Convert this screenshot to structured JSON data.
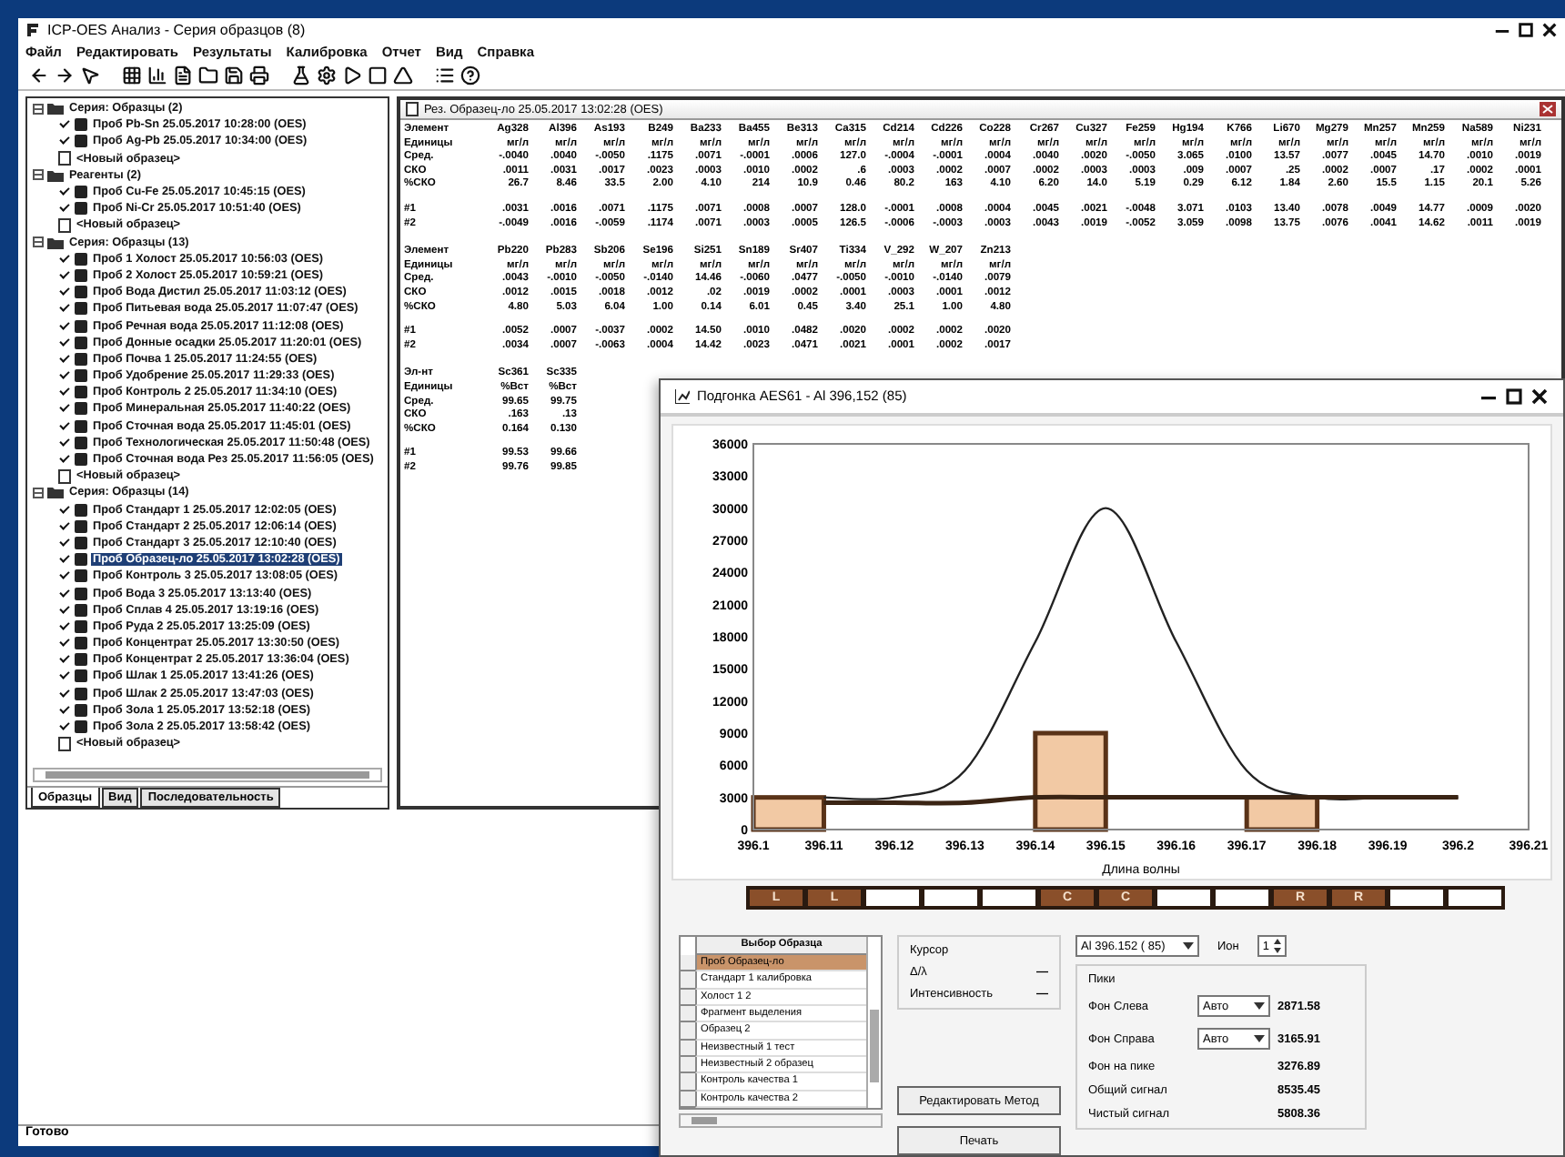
{
  "window": {
    "title": "ICP-OES Анализ - Серия образцов (8)"
  },
  "menu": [
    "Файл",
    "Редактировать",
    "Результаты",
    "Калибровка",
    "Отчет",
    "Вид",
    "Справка"
  ],
  "tree": {
    "groups": [
      {
        "label": "Серия: Образцы (2)",
        "expanded": true,
        "new_item": "<Новый образец>",
        "children": [
          {
            "label": "Проб Pb-Sn 25.05.2017 10:28:00 (OES)",
            "checked": true,
            "selected": false
          },
          {
            "label": "Проб Ag-Pb 25.05.2017 10:34:00 (OES)",
            "checked": true,
            "selected": false
          }
        ]
      },
      {
        "label": "Реагенты (2)",
        "expanded": true,
        "new_item": "<Новый образец>",
        "children": [
          {
            "label": "Проб Cu-Fe 25.05.2017 10:45:15 (OES)",
            "checked": true,
            "selected": false
          },
          {
            "label": "Проб Ni-Cr 25.05.2017 10:51:40 (OES)",
            "checked": true,
            "selected": false
          }
        ]
      },
      {
        "label": "Серия: Образцы (13)",
        "expanded": true,
        "new_item": "<Новый образец>",
        "children": [
          {
            "label": "Проб 1 Холост 25.05.2017 10:56:03 (OES)",
            "checked": true,
            "selected": false
          },
          {
            "label": "Проб 2 Холост 25.05.2017 10:59:21 (OES)",
            "checked": true,
            "selected": false
          },
          {
            "label": "Проб Вода Дистил 25.05.2017 11:03:12 (OES)",
            "checked": true,
            "selected": false
          },
          {
            "label": "Проб Питьевая вода 25.05.2017 11:07:47 (OES)",
            "checked": true,
            "selected": false
          },
          {
            "label": "Проб Речная вода 25.05.2017 11:12:08 (OES)",
            "checked": true,
            "selected": false
          },
          {
            "label": "Проб Донные осадки 25.05.2017 11:20:01 (OES)",
            "checked": true,
            "selected": false
          },
          {
            "label": "Проб Почва 1 25.05.2017 11:24:55 (OES)",
            "checked": true,
            "selected": false
          },
          {
            "label": "Проб Удобрение 25.05.2017 11:29:33 (OES)",
            "checked": true,
            "selected": false
          },
          {
            "label": "Проб Контроль 2 25.05.2017 11:34:10 (OES)",
            "checked": true,
            "selected": false
          },
          {
            "label": "Проб Минеральная 25.05.2017 11:40:22 (OES)",
            "checked": true,
            "selected": false
          },
          {
            "label": "Проб Сточная вода 25.05.2017 11:45:01 (OES)",
            "checked": true,
            "selected": false
          },
          {
            "label": "Проб Технологическая 25.05.2017 11:50:48 (OES)",
            "checked": true,
            "selected": false
          },
          {
            "label": "Проб Сточная вода Рез 25.05.2017 11:56:05 (OES)",
            "checked": true,
            "selected": false
          }
        ]
      },
      {
        "label": "Серия: Образцы (14)",
        "expanded": true,
        "new_item": "<Новый образец>",
        "children": [
          {
            "label": "Проб Стандарт 1 25.05.2017 12:02:05 (OES)",
            "checked": true,
            "selected": false
          },
          {
            "label": "Проб Стандарт 2 25.05.2017 12:06:14 (OES)",
            "checked": true,
            "selected": false
          },
          {
            "label": "Проб Стандарт 3 25.05.2017 12:10:40 (OES)",
            "checked": true,
            "selected": false
          },
          {
            "label": "Проб Образец-ло 25.05.2017 13:02:28 (OES)",
            "checked": true,
            "selected": true
          },
          {
            "label": "Проб Контроль 3 25.05.2017 13:08:05 (OES)",
            "checked": true,
            "selected": false
          },
          {
            "label": "Проб Вода 3 25.05.2017 13:13:40 (OES)",
            "checked": true,
            "selected": false
          },
          {
            "label": "Проб Сплав 4 25.05.2017 13:19:16 (OES)",
            "checked": true,
            "selected": false
          },
          {
            "label": "Проб Руда 2 25.05.2017 13:25:09 (OES)",
            "checked": true,
            "selected": false
          },
          {
            "label": "Проб Концентрат 25.05.2017 13:30:50 (OES)",
            "checked": true,
            "selected": false
          },
          {
            "label": "Проб Концентрат 2 25.05.2017 13:36:04 (OES)",
            "checked": true,
            "selected": false
          },
          {
            "label": "Проб Шлак 1 25.05.2017 13:41:26 (OES)",
            "checked": true,
            "selected": false
          },
          {
            "label": "Проб Шлак 2 25.05.2017 13:47:03 (OES)",
            "checked": true,
            "selected": false
          },
          {
            "label": "Проб Зола 1 25.05.2017 13:52:18 (OES)",
            "checked": true,
            "selected": false
          },
          {
            "label": "Проб Зола 2 25.05.2017 13:58:42 (OES)",
            "checked": true,
            "selected": false
          }
        ]
      }
    ]
  },
  "panel_tabs": [
    {
      "label": "Образцы",
      "selected": true
    },
    {
      "label": "Вид",
      "selected": false
    },
    {
      "label": "Последовательность",
      "selected": false
    }
  ],
  "status_bar": "Готово",
  "results": {
    "title": "Рез. Образец-ло 25.05.2017 13:02:28 (OES)",
    "blocks": [
      {
        "label": "Элемент",
        "columns": [
          "Ag328",
          "Al396",
          "As193",
          "B249",
          "Ba233",
          "Ba455",
          "Be313",
          "Ca315",
          "Cd214",
          "Cd226",
          "Co228",
          "Cr267",
          "Cu327",
          "Fe259",
          "Hg194",
          "K766",
          "Li670",
          "Mg279",
          "Mn257",
          "Mn259",
          "Na589",
          "Ni231"
        ],
        "stats": [
          {
            "label": "Единицы",
            "values": [
              "мг/л",
              "мг/л",
              "мг/л",
              "мг/л",
              "мг/л",
              "мг/л",
              "мг/л",
              "мг/л",
              "мг/л",
              "мг/л",
              "мг/л",
              "мг/л",
              "мг/л",
              "мг/л",
              "мг/л",
              "мг/л",
              "мг/л",
              "мг/л",
              "мг/л",
              "мг/л",
              "мг/л",
              "мг/л"
            ]
          },
          {
            "label": "Сред.",
            "values": [
              "-.0040",
              ".0040",
              "-.0050",
              ".1175",
              ".0071",
              "-.0001",
              ".0006",
              "127.0",
              "-.0004",
              "-.0001",
              ".0004",
              ".0040",
              ".0020",
              "-.0050",
              "3.065",
              ".0100",
              "13.57",
              ".0077",
              ".0045",
              "14.70",
              ".0010",
              ".0019"
            ]
          },
          {
            "label": "СКО",
            "values": [
              ".0011",
              ".0031",
              ".0017",
              ".0023",
              ".0003",
              ".0010",
              ".0002",
              ".6",
              ".0003",
              ".0002",
              ".0007",
              ".0002",
              ".0003",
              ".0003",
              ".009",
              ".0007",
              ".25",
              ".0002",
              ".0007",
              ".17",
              ".0002",
              ".0001"
            ]
          },
          {
            "label": "%СКО",
            "values": [
              "26.7",
              "8.46",
              "33.5",
              "2.00",
              "4.10",
              "214",
              "10.9",
              "0.46",
              "80.2",
              "163",
              "4.10",
              "6.20",
              "14.0",
              "5.19",
              "0.29",
              "6.12",
              "1.84",
              "2.60",
              "15.5",
              "1.15",
              "20.1",
              "5.26"
            ]
          }
        ],
        "replicates": [
          {
            "label": "#1",
            "values": [
              ".0031",
              ".0016",
              ".0071",
              ".1175",
              ".0071",
              ".0008",
              ".0007",
              "128.0",
              "-.0001",
              ".0008",
              ".0004",
              ".0045",
              ".0021",
              "-.0048",
              "3.071",
              ".0103",
              "13.40",
              ".0078",
              ".0049",
              "14.77",
              ".0009",
              ".0020"
            ]
          },
          {
            "label": "#2",
            "values": [
              "-.0049",
              ".0016",
              "-.0059",
              ".1174",
              ".0071",
              ".0003",
              ".0005",
              "126.5",
              "-.0006",
              "-.0003",
              ".0003",
              ".0043",
              ".0019",
              "-.0052",
              "3.059",
              ".0098",
              "13.75",
              ".0076",
              ".0041",
              "14.62",
              ".0011",
              ".0019"
            ]
          }
        ]
      },
      {
        "label": "Элемент",
        "columns": [
          "Pb220",
          "Pb283",
          "Sb206",
          "Se196",
          "Si251",
          "Sn189",
          "Sr407",
          "Ti334",
          "V_292",
          "W_207",
          "Zn213"
        ],
        "stats": [
          {
            "label": "Единицы",
            "values": [
              "мг/л",
              "мг/л",
              "мг/л",
              "мг/л",
              "мг/л",
              "мг/л",
              "мг/л",
              "мг/л",
              "мг/л",
              "мг/л",
              "мг/л"
            ]
          },
          {
            "label": "Сред.",
            "values": [
              ".0043",
              "-.0010",
              "-.0050",
              "-.0140",
              "14.46",
              "-.0060",
              ".0477",
              "-.0050",
              "-.0010",
              "-.0140",
              ".0079"
            ]
          },
          {
            "label": "СКО",
            "values": [
              ".0012",
              ".0015",
              ".0018",
              ".0012",
              ".02",
              ".0019",
              ".0002",
              ".0001",
              ".0003",
              ".0001",
              ".0012"
            ]
          },
          {
            "label": "%СКО",
            "values": [
              "4.80",
              "5.03",
              "6.04",
              "1.00",
              "0.14",
              "6.01",
              "0.45",
              "3.40",
              "25.1",
              "1.00",
              "4.80"
            ]
          }
        ],
        "replicates": [
          {
            "label": "#1",
            "values": [
              ".0052",
              ".0007",
              "-.0037",
              ".0002",
              "14.50",
              ".0010",
              ".0482",
              ".0020",
              ".0002",
              ".0002",
              ".0020"
            ]
          },
          {
            "label": "#2",
            "values": [
              ".0034",
              ".0007",
              "-.0063",
              ".0004",
              "14.42",
              ".0023",
              ".0471",
              ".0021",
              ".0001",
              ".0002",
              ".0017"
            ]
          }
        ]
      },
      {
        "label": "Эл-нт",
        "columns": [
          "Sc361",
          "Sc335"
        ],
        "stats": [
          {
            "label": "Единицы",
            "values": [
              "%Вст",
              "%Вст"
            ]
          },
          {
            "label": "Сред.",
            "values": [
              "99.65",
              "99.75"
            ]
          },
          {
            "label": "СКО",
            "values": [
              ".163",
              ".13"
            ]
          },
          {
            "label": "%СКО",
            "values": [
              "0.164",
              "0.130"
            ]
          }
        ],
        "replicates": [
          {
            "label": "#1",
            "values": [
              "99.53",
              "99.66"
            ]
          },
          {
            "label": "#2",
            "values": [
              "99.76",
              "99.85"
            ]
          }
        ]
      }
    ]
  },
  "dialog": {
    "title": "Подгонка AES61 - Al 396,152 (85)",
    "chart_data": {
      "type": "line",
      "xlabel": "Длина волны",
      "xlim": [
        396.1,
        396.21
      ],
      "ylim": [
        0,
        36000
      ],
      "xticks": [
        {
          "value": 396.1,
          "label": "396.1"
        },
        {
          "value": 396.11,
          "label": "396.11"
        },
        {
          "value": 396.12,
          "label": "396.12"
        },
        {
          "value": 396.13,
          "label": "396.13"
        },
        {
          "value": 396.14,
          "label": "396.14"
        },
        {
          "value": 396.15,
          "label": "396.15"
        },
        {
          "value": 396.16,
          "label": "396.16"
        },
        {
          "value": 396.17,
          "label": "396.17"
        },
        {
          "value": 396.18,
          "label": "396.18"
        },
        {
          "value": 396.19,
          "label": "396.19"
        },
        {
          "value": 396.2,
          "label": "396.2"
        },
        {
          "value": 396.21,
          "label": "396.21"
        }
      ],
      "yticks": [
        0,
        3000,
        6000,
        9000,
        12000,
        15000,
        18000,
        21000,
        24000,
        27000,
        30000,
        33000,
        36000
      ],
      "x": [
        396.11,
        396.12,
        396.13,
        396.14,
        396.15,
        396.16,
        396.17,
        396.18,
        396.19,
        396.2
      ],
      "series": [
        {
          "color": "#222222",
          "values": [
            3000,
            3000,
            5500,
            17500,
            30000,
            17500,
            5500,
            3000,
            3000,
            3000
          ]
        },
        {
          "color": "#3a2414",
          "values": [
            2500,
            2500,
            2500,
            3000,
            3000,
            3000,
            3000,
            3000,
            3000,
            3000
          ]
        }
      ]
    },
    "markers": [
      {
        "label": "L",
        "filled": true
      },
      {
        "label": "L",
        "filled": true
      },
      {
        "filled": false
      },
      {
        "filled": false
      },
      {
        "filled": false
      },
      {
        "label": "C",
        "filled": true
      },
      {
        "label": "C",
        "filled": true
      },
      {
        "filled": false
      },
      {
        "filled": false
      },
      {
        "label": "R",
        "filled": true
      },
      {
        "label": "R",
        "filled": true
      },
      {
        "filled": false
      },
      {
        "filled": false
      }
    ],
    "sample_list": {
      "header": "Выбор Образца",
      "rows": [
        {
          "label": "Проб Образец-ло",
          "selected": true
        },
        {
          "label": "Стандарт 1 калибровка",
          "selected": false
        },
        {
          "label": "Холост 1 2",
          "selected": false
        },
        {
          "label": "Фрагмент выделения",
          "selected": false
        },
        {
          "label": "Образец 2",
          "selected": false
        },
        {
          "label": "Неизвестный 1 тест",
          "selected": false
        },
        {
          "label": "Неизвестный 2 образец",
          "selected": false
        },
        {
          "label": "Контроль качества 1",
          "selected": false
        },
        {
          "label": "Контроль качества 2",
          "selected": false
        }
      ]
    },
    "cursor": {
      "title": "Курсор",
      "rows": [
        {
          "label": "Δ/λ",
          "value": "—"
        },
        {
          "label": "Интенсивность",
          "value": "—"
        }
      ]
    },
    "line_select": "Al 396.152 ( 85)",
    "ion_label": "Ион",
    "ion_value": "1",
    "peaks": {
      "title": "Пики",
      "backgrounds": [
        {
          "label": "Фон Слева",
          "mode": "Авто",
          "value": "2871.58"
        },
        {
          "label": "Фон Справа",
          "mode": "Авто",
          "value": "3165.91"
        }
      ],
      "readings": [
        {
          "label": "Фон на пике",
          "value": "3276.89"
        },
        {
          "label": "Общий сигнал",
          "value": "8535.45"
        },
        {
          "label": "Чистый сигнал",
          "value": "5808.36"
        }
      ]
    },
    "buttons": [
      "Редактировать Метод",
      "Печать"
    ]
  }
}
